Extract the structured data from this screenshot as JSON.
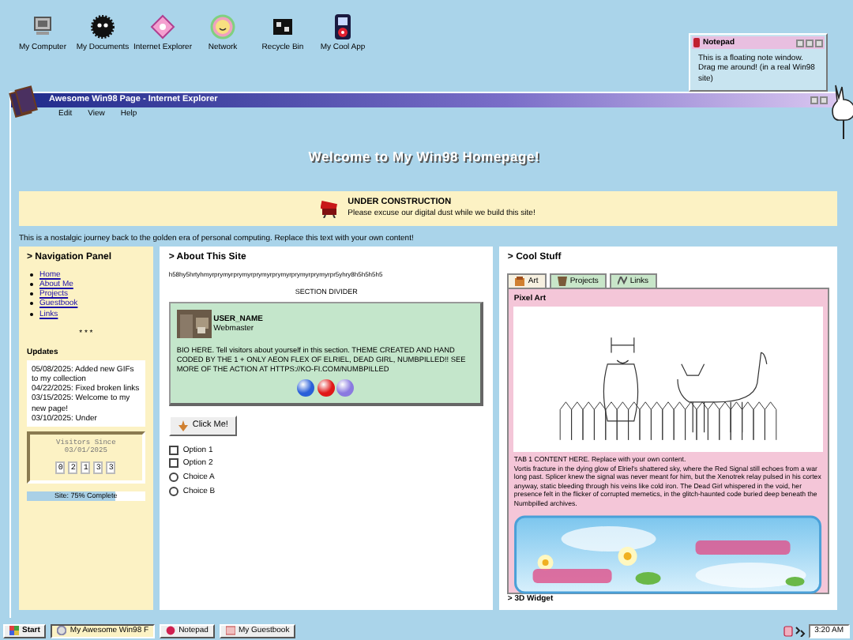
{
  "desktop_icons": [
    {
      "label": "My Computer",
      "kind": "computer"
    },
    {
      "label": "My Documents",
      "kind": "fuzzball"
    },
    {
      "label": "Internet Explorer",
      "kind": "diamond"
    },
    {
      "label": "Network",
      "kind": "smiley"
    },
    {
      "label": "Recycle Bin",
      "kind": "bin"
    },
    {
      "label": "My Cool App",
      "kind": "player"
    }
  ],
  "notepad": {
    "title": "Notepad",
    "text": "This is a floating note window. Drag me around! (in a real Win98 site)"
  },
  "browser": {
    "title": "Awesome Win98 Page - Internet Explorer",
    "menu": [
      "Edit",
      "View",
      "Help"
    ],
    "heading": "Welcome to My Win98 Homepage!",
    "construction": {
      "title": "UNDER CONSTRUCTION",
      "text": "Please excuse our digital dust while we build this site!"
    },
    "intro": "This is a nostalgic journey back to the golden era of personal computing. Replace this text with your own content!",
    "nav": {
      "title": "> Navigation Panel",
      "links": [
        "Home",
        "About Me",
        "Projects",
        "Guestbook",
        "Links"
      ],
      "divider": "* * *",
      "updates_title": "Updates",
      "updates": [
        "05/08/2025: Added new GIFs to my collection",
        "04/22/2025: Fixed broken links",
        "03/15/2025: Welcome to my new page!",
        "03/10/2025: Under"
      ],
      "counter": {
        "title": "Visitors Since",
        "date": "03/01/2025",
        "digits": [
          "0",
          "2",
          "1",
          "3",
          "3"
        ]
      },
      "progress": {
        "label": "Site: 75% Complete",
        "level": 0.75
      }
    },
    "about": {
      "title": "> About This Site",
      "code": "h58hy5hrtyhmyrprymyrprymyrprymyrprymyrprymyrprymyrpr5yhry8h5h5h5h5",
      "divider": "SECTION DIVIDER",
      "profile": {
        "name": "USER_NAME",
        "role": "Webmaster",
        "bio": "BIO HERE. Tell visitors about yourself in this section. THEME CREATED AND HAND CODED BY THE 1 + ONLY AEON FLEX OF ELRIEL, DEAD GIRL, NUMBPILLED!! SEE MORE OF THE ACTION AT HTTPS://KO-FI.COM/NUMBPILLED",
        "orbs": [
          {
            "color": "#2a5fd8"
          },
          {
            "color": "#e01818"
          },
          {
            "color": "#8a7ae0"
          }
        ]
      },
      "button": "Click Me!",
      "checkboxes": [
        {
          "label": "Option 1",
          "checked": false
        },
        {
          "label": "Option 2",
          "checked": false
        }
      ],
      "radios": [
        {
          "label": "Choice A",
          "selected": false
        },
        {
          "label": "Choice B",
          "selected": false
        }
      ]
    },
    "cool": {
      "title": "> Cool Stuff",
      "tabs": [
        {
          "label": "Art",
          "selected": true
        },
        {
          "label": "Projects",
          "selected": false
        },
        {
          "label": "Links",
          "selected": false
        }
      ],
      "panel_title": "Pixel Art",
      "lead": "TAB 1 CONTENT HERE. Replace with your own content.",
      "body": "Vortis fracture in the dying glow of Elriel's shattered sky, where the Red Signal still echoes from a war long past. Splicer knew the signal was never meant for him, but the Xenotrek relay pulsed in his cortex anyway, static bleeding through his veins like cold iron. The Dead Girl whispered in the void, her presence felt in the flicker of corrupted memetics, in the glitch-haunted code buried deep beneath the Numbpilled archives."
    },
    "widget_title": "> 3D Widget"
  },
  "taskbar": {
    "start": "Start",
    "tasks": [
      {
        "label": "My Awesome Win98 F",
        "selected": true
      },
      {
        "label": "Notepad",
        "selected": false
      },
      {
        "label": "My Guestbook",
        "selected": false
      }
    ],
    "clock": "3:20 AM"
  }
}
